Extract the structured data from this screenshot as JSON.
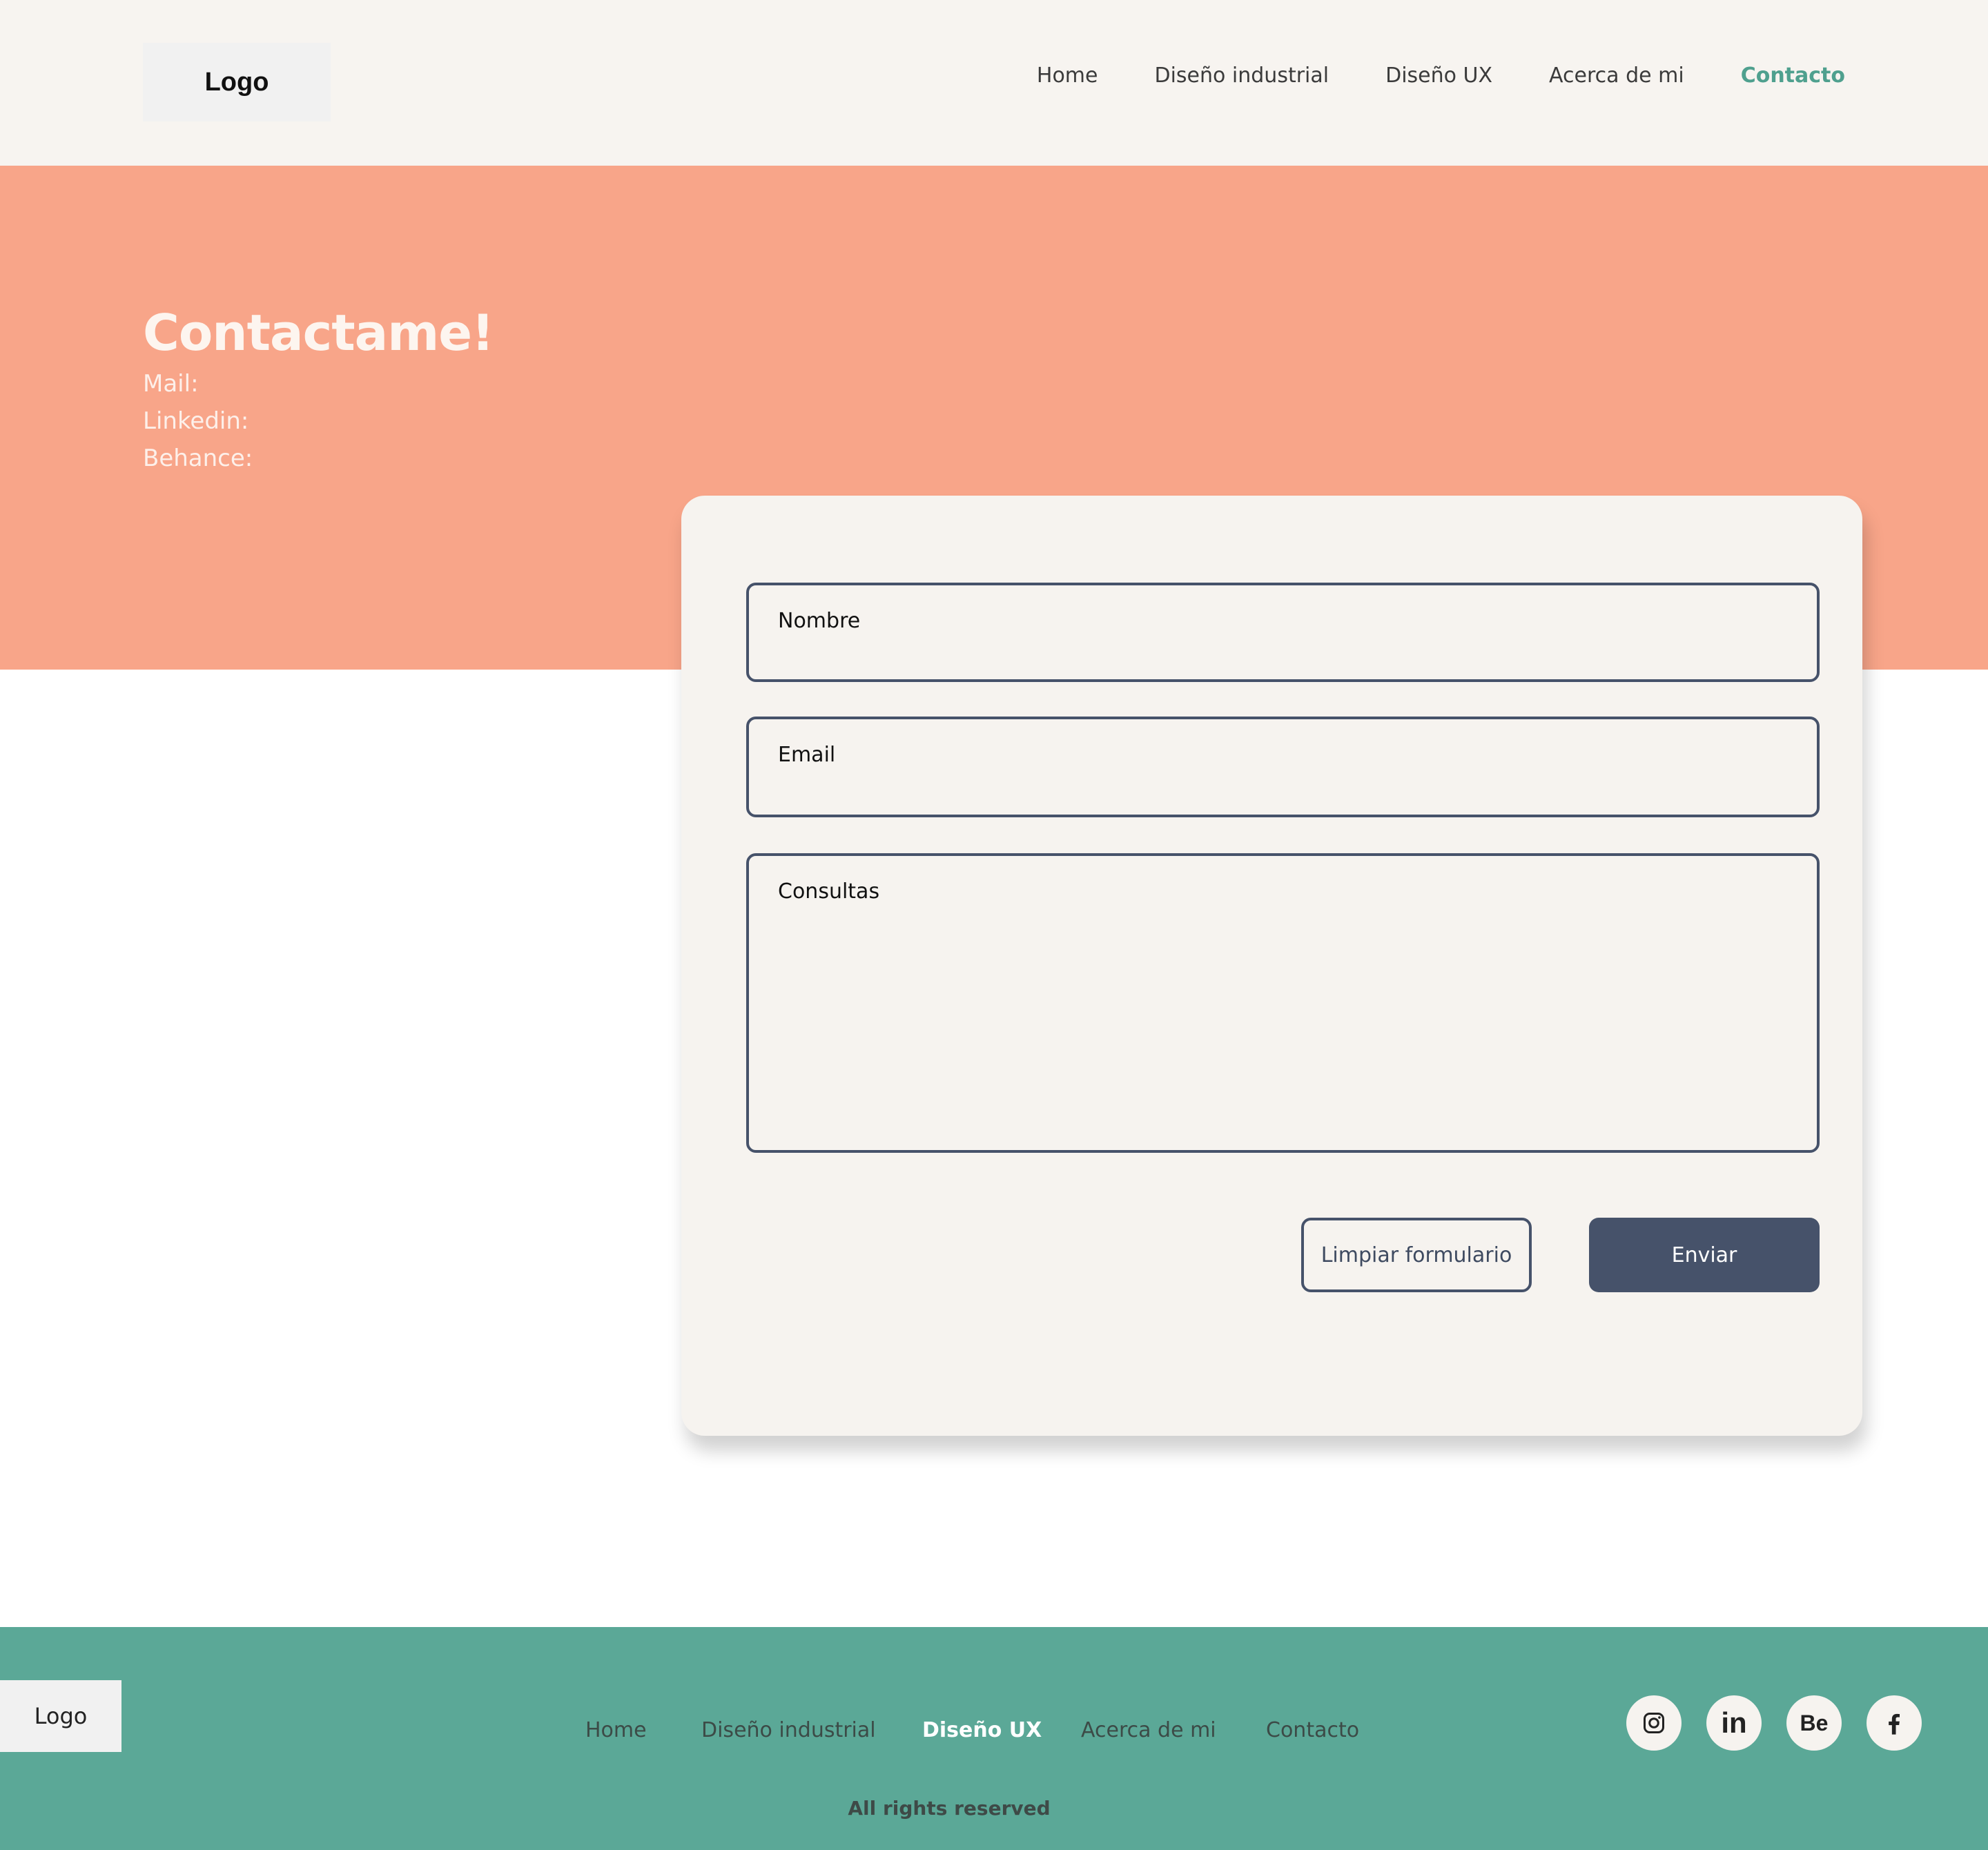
{
  "header": {
    "logo": "Logo",
    "nav": [
      {
        "label": "Home"
      },
      {
        "label": "Diseño industrial"
      },
      {
        "label": "Diseño UX"
      },
      {
        "label": "Acerca de mi"
      },
      {
        "label": "Contacto",
        "active": true
      }
    ]
  },
  "hero": {
    "title": "Contactame!",
    "lines": [
      "Mail:",
      "Linkedin:",
      "Behance:"
    ]
  },
  "form": {
    "name_placeholder": "Nombre",
    "email_placeholder": "Email",
    "message_placeholder": "Consultas",
    "clear_label": "Limpiar formulario",
    "submit_label": "Enviar"
  },
  "footer": {
    "logo": "Logo",
    "nav": [
      {
        "label": "Home"
      },
      {
        "label": "Diseño industrial"
      },
      {
        "label": "Diseño UX",
        "active": true
      },
      {
        "label": "Acerca de mi"
      },
      {
        "label": "Contacto"
      }
    ],
    "rights": "All rights reserved",
    "social": [
      {
        "icon": "instagram-icon"
      },
      {
        "icon": "linkedin-icon",
        "text": "in"
      },
      {
        "icon": "behance-icon",
        "text": "Be"
      },
      {
        "icon": "facebook-icon"
      }
    ]
  },
  "colors": {
    "header_bg": "#f7f4f0",
    "hero_bg": "#f8a589",
    "footer_bg": "#5ba897",
    "accent": "#4fa08e",
    "button": "#46526a"
  }
}
